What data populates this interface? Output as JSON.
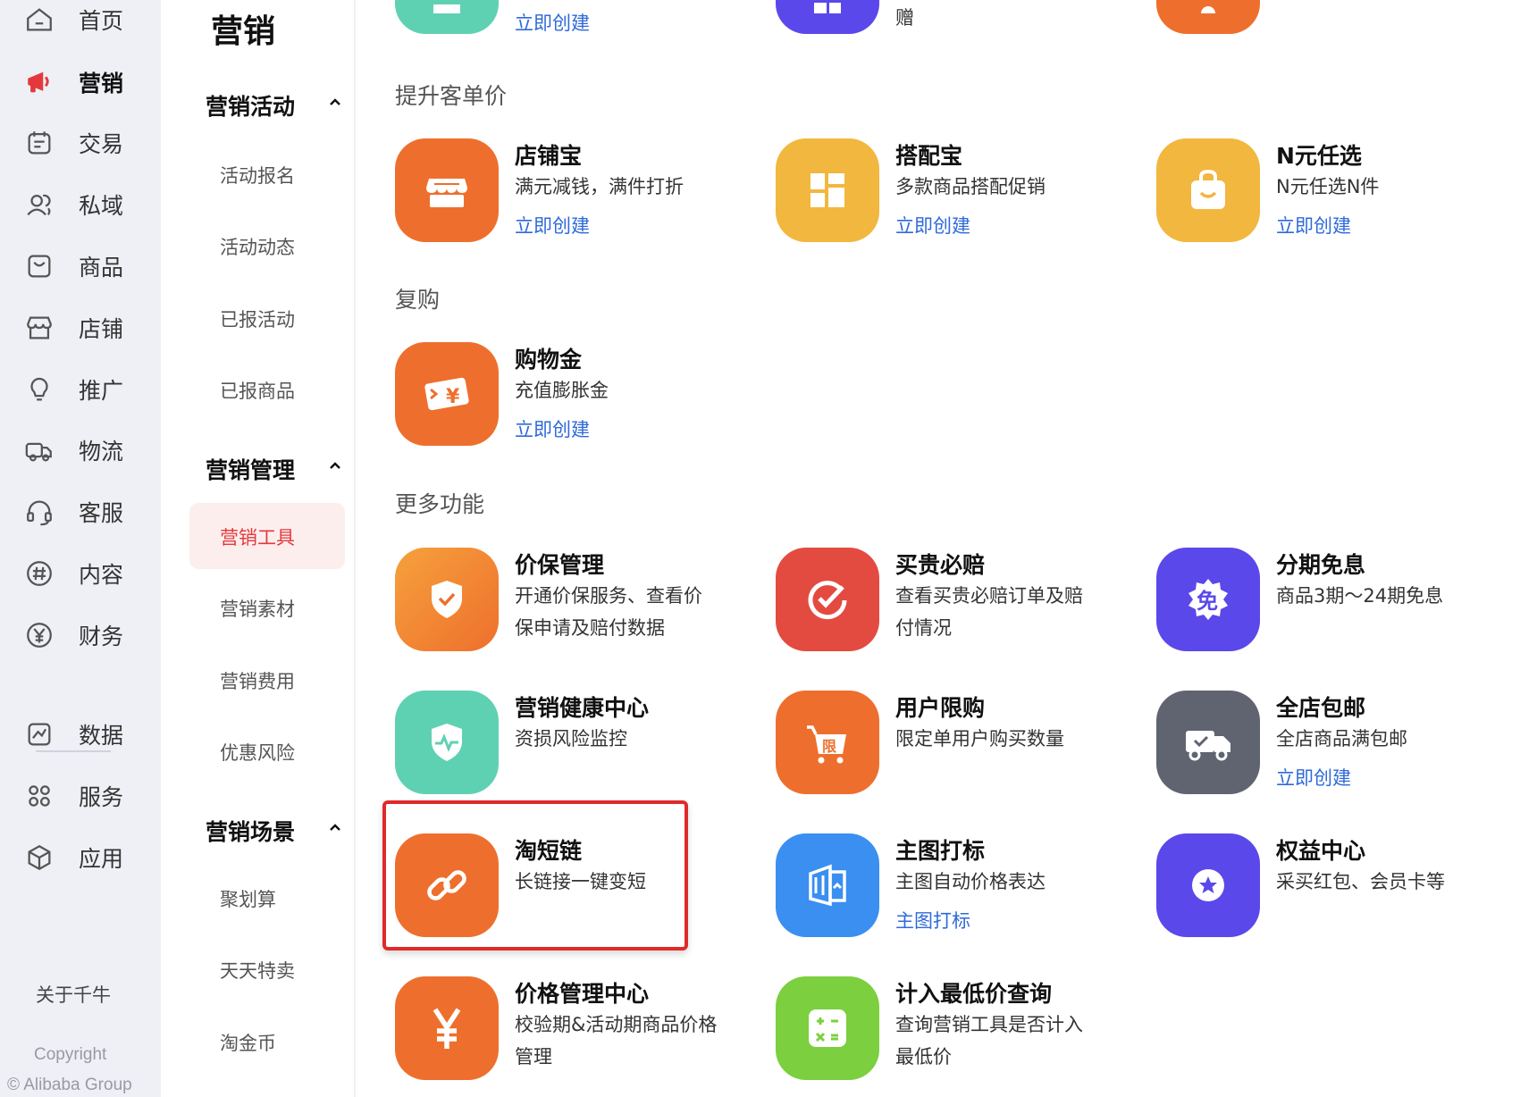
{
  "nav": {
    "items": [
      {
        "label": "首页",
        "icon": "home-icon"
      },
      {
        "label": "营销",
        "icon": "megaphone-icon",
        "active": true
      },
      {
        "label": "交易",
        "icon": "receipt-icon"
      },
      {
        "label": "私域",
        "icon": "users-icon"
      },
      {
        "label": "商品",
        "icon": "bag-icon"
      },
      {
        "label": "店铺",
        "icon": "store-icon"
      },
      {
        "label": "推广",
        "icon": "lightbulb-icon"
      },
      {
        "label": "物流",
        "icon": "truck-icon"
      },
      {
        "label": "客服",
        "icon": "headset-icon"
      },
      {
        "label": "内容",
        "icon": "hashtag-icon"
      },
      {
        "label": "财务",
        "icon": "yen-icon"
      },
      {
        "label": "数据",
        "icon": "chart-icon"
      },
      {
        "label": "服务",
        "icon": "grid-icon"
      },
      {
        "label": "应用",
        "icon": "cube-icon"
      }
    ],
    "about": "关于千牛",
    "copyright_line1": "Copyright",
    "copyright_line2": "© Alibaba Group"
  },
  "submenu": {
    "title": "营销",
    "groups": [
      {
        "label": "营销活动",
        "items": [
          "活动报名",
          "活动动态",
          "已报活动",
          "已报商品"
        ]
      },
      {
        "label": "营销管理",
        "items": [
          "营销工具",
          "营销素材",
          "营销费用",
          "优惠风险"
        ],
        "active_item": "营销工具"
      },
      {
        "label": "营销场景",
        "items": [
          "聚划算",
          "天天特卖",
          "淘金币"
        ]
      }
    ]
  },
  "main": {
    "top_row": {
      "link": "立即创建",
      "partial_text": "赠"
    },
    "sections": {
      "upsell": "提升客单价",
      "repurchase": "复购",
      "more": "更多功能"
    },
    "cards": {
      "dianpubao": {
        "name": "店铺宝",
        "desc": "满元减钱，满件打折",
        "link": "立即创建"
      },
      "dapeibao": {
        "name": "搭配宝",
        "desc": "多款商品搭配促销",
        "link": "立即创建"
      },
      "nyuan": {
        "name": "N元任选",
        "desc": "N元任选N件",
        "link": "立即创建"
      },
      "gouwujin": {
        "name": "购物金",
        "desc": "充值膨胀金",
        "link": "立即创建"
      },
      "jiabao": {
        "name": "价保管理",
        "desc": "开通价保服务、查看价保申请及赔付数据"
      },
      "maigui": {
        "name": "买贵必赔",
        "desc": "查看买贵必赔订单及赔付情况"
      },
      "fenqi": {
        "name": "分期免息",
        "desc": "商品3期～24期免息"
      },
      "jiankang": {
        "name": "营销健康中心",
        "desc": "资损风险监控"
      },
      "xiangou": {
        "name": "用户限购",
        "desc": "限定单用户购买数量"
      },
      "baoyou": {
        "name": "全店包邮",
        "desc": "全店商品满包邮",
        "link": "立即创建"
      },
      "duanlian": {
        "name": "淘短链",
        "desc": "长链接一键变短"
      },
      "zhutu": {
        "name": "主图打标",
        "desc": "主图自动价格表达",
        "link": "主图打标"
      },
      "quanyi": {
        "name": "权益中心",
        "desc": "采买红包、会员卡等"
      },
      "jiage": {
        "name": "价格管理中心",
        "desc": "校验期&活动期商品价格管理"
      },
      "zuidi": {
        "name": "计入最低价查询",
        "desc": "查询营销工具是否计入最低价"
      }
    }
  },
  "colors": {
    "orange": "#ee6f2d",
    "yellow": "#f2b73f",
    "teal": "#5fd1b3",
    "red": "#e44b40",
    "purple": "#5b48ea",
    "gray": "#5f6470",
    "blue": "#3a8ff0",
    "green": "#7ccf3f",
    "link": "#2f6ad9",
    "active_red": "#e4393c"
  }
}
